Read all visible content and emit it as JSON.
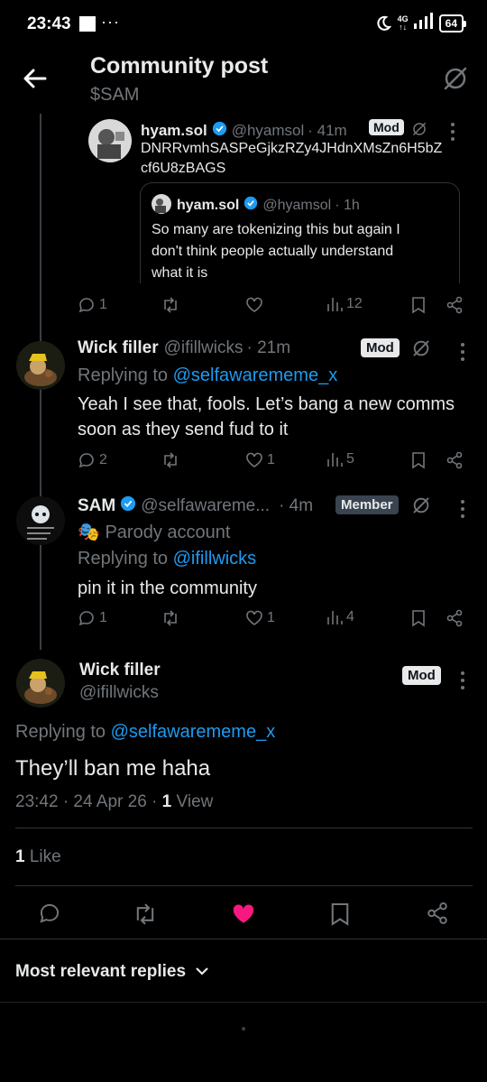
{
  "status_bar": {
    "time": "23:43",
    "dots": "···",
    "network": "4G",
    "battery": "64"
  },
  "header": {
    "title": "Community post",
    "subtitle": "$SAM"
  },
  "posts": [
    {
      "name": "hyam.sol",
      "handle": "@hyamsol",
      "time": "· 41m",
      "badge": "Mod",
      "text_line1": "DNRRvmhSASPeGjkzRZy4JHdnXMsZn6H5bZ",
      "text_line2": "cf6U8zBAGS",
      "quote": {
        "name": "hyam.sol",
        "handle": "@hyamsol",
        "time": "· 1h",
        "line1": "So many are tokenizing this but again I",
        "line2": "don't think people actually understand",
        "line3": "what it is"
      },
      "actions": {
        "replies": "1",
        "reposts": "",
        "likes": "",
        "views": "12"
      }
    },
    {
      "name": "Wick filler",
      "handle": "@ifillwicks",
      "time": "· 21m",
      "badge": "Mod",
      "replying_prefix": "Replying to",
      "replying_to": "@selfawarememe_x",
      "line1": "Yeah I see that, fools. Let’s bang a new comms",
      "line2": "soon as they send fud to it",
      "actions": {
        "replies": "2",
        "reposts": "",
        "likes": "1",
        "views": "5"
      }
    },
    {
      "name": "SAM",
      "handle": "@selfawareme...",
      "time": "· 4m",
      "badge": "Member",
      "parody_icon": "🎭",
      "parody": "Parody account",
      "replying_prefix": "Replying to",
      "replying_to": "@ifillwicks",
      "line1": "pin it in the community",
      "actions": {
        "replies": "1",
        "reposts": "",
        "likes": "1",
        "views": "4"
      }
    }
  ],
  "main_post": {
    "name": "Wick filler",
    "handle": "@ifillwicks",
    "badge": "Mod",
    "replying_prefix": "Replying to",
    "replying_to": "@selfawarememe_x",
    "text": "They’ll ban me haha",
    "timestamp": "23:42 · 24 Apr 26 ·",
    "views_count": "1",
    "views_label": "View",
    "likes_count": "1",
    "likes_label": "Like"
  },
  "sort": {
    "label": "Most relevant replies"
  },
  "colors": {
    "accent": "#1d9bf0",
    "like": "#f91880",
    "muted": "#71767b",
    "text": "#e7e9ea"
  }
}
